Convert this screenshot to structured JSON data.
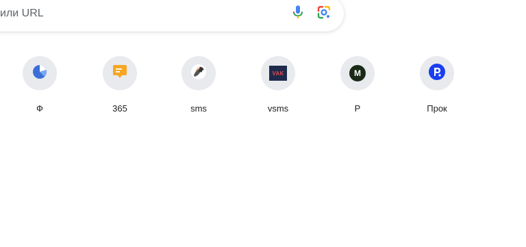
{
  "search": {
    "placeholder_visible": "или URL",
    "mic_icon": "microphone-icon",
    "lens_icon": "google-lens-icon"
  },
  "shortcuts": [
    {
      "label": "Ф",
      "icon": "pie-chart-icon",
      "color": "#3a6fd8"
    },
    {
      "label": "365",
      "icon": "chat-message-icon",
      "color": "#f5a623"
    },
    {
      "label": "sms",
      "icon": "hand-phone-icon",
      "color": "#333333"
    },
    {
      "label": "vsms",
      "icon": "vak-logo-icon",
      "badge_text": "VAK",
      "color": "#1f2a4d"
    },
    {
      "label": "Р",
      "icon": "m-logo-icon",
      "badge_text": "M",
      "color": "#1a2a17"
    },
    {
      "label": "Прок",
      "icon": "p-circle-logo-icon",
      "color": "#1a3ef0"
    }
  ]
}
